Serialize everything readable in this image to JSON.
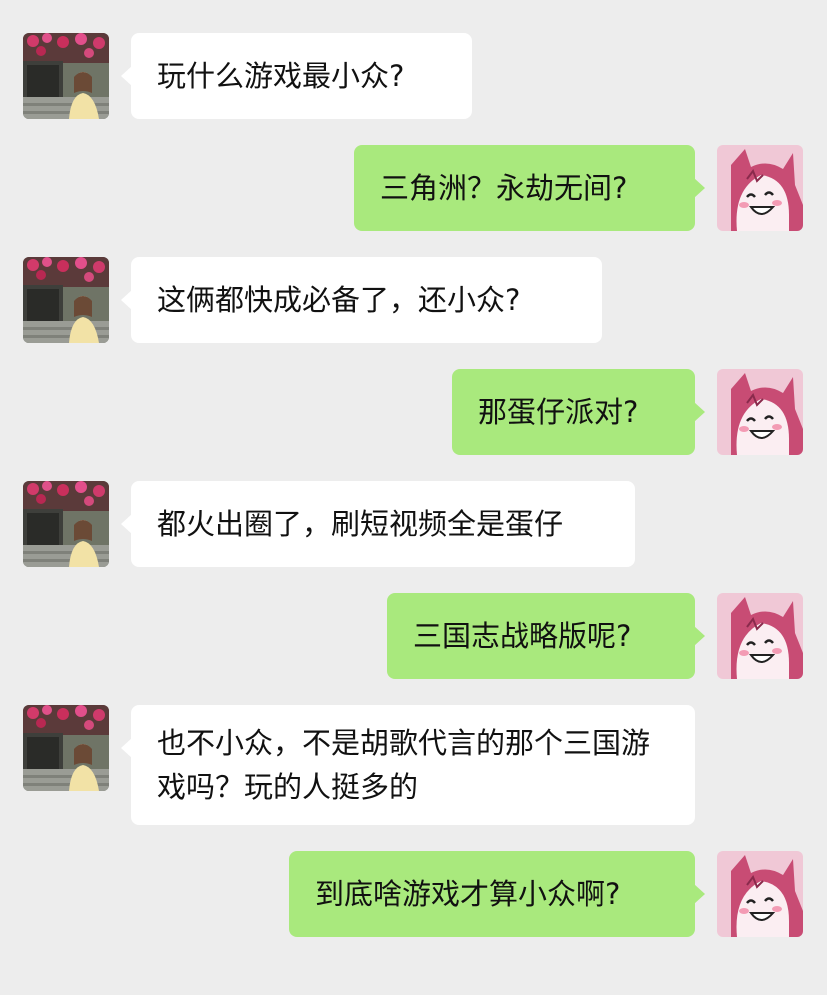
{
  "conversation": {
    "messages": [
      {
        "side": "left",
        "sender": "friend",
        "text": "玩什么游戏最小众?"
      },
      {
        "side": "right",
        "sender": "me",
        "text": "三角洲？永劫无间?"
      },
      {
        "side": "left",
        "sender": "friend",
        "text": "这俩都快成必备了，还小众?"
      },
      {
        "side": "right",
        "sender": "me",
        "text": "那蛋仔派对?"
      },
      {
        "side": "left",
        "sender": "friend",
        "text": "都火出圈了，刷短视频全是蛋仔"
      },
      {
        "side": "right",
        "sender": "me",
        "text": "三国志战略版呢?"
      },
      {
        "side": "left",
        "sender": "friend",
        "text": "也不小众，不是胡歌代言的那个三国游戏吗？玩的人挺多的"
      },
      {
        "side": "right",
        "sender": "me",
        "text": "到底啥游戏才算小众啊?"
      }
    ]
  },
  "colors": {
    "background": "#ededed",
    "incoming_bubble": "#ffffff",
    "outgoing_bubble": "#a9e97d",
    "text": "#111111"
  },
  "icons": {
    "friend_avatar": "photo-avatar-girl-with-flowers",
    "my_avatar": "cartoon-devil-hood-avatar"
  }
}
